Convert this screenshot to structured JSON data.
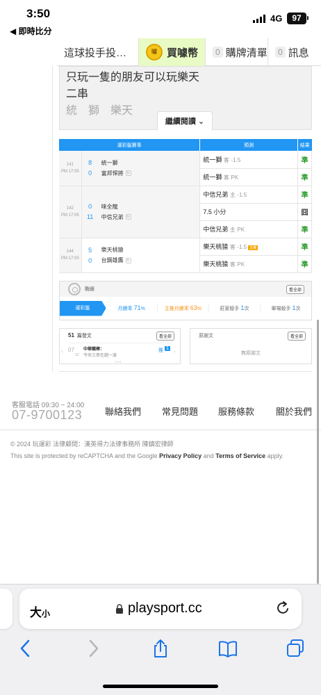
{
  "status_bar": {
    "time": "3:50",
    "back_app": "◀ 即時比分",
    "network": "4G",
    "battery": "97"
  },
  "topnav": {
    "post_label": "這球投手投…",
    "buy_label": "買噱幣",
    "coin_icon_text": "噱",
    "cart_count": "0",
    "cart_label": "購牌清單",
    "msg_count": "0",
    "msg_label": "訊息"
  },
  "article": {
    "lines": [
      "只玩一隻的朋友可以玩樂天",
      "二串",
      "統　獅　樂天"
    ],
    "read_more": "繼續閱讀"
  },
  "predictions": {
    "headers": {
      "game": "運彩盤賽事",
      "pick": "預測",
      "result": "結果"
    },
    "games": [
      {
        "no": "141",
        "time": "PM 17:05",
        "teams": [
          {
            "score": "8",
            "name": "統一獅"
          },
          {
            "score": "0",
            "name": "富邦悍將"
          }
        ],
        "picks": [
          {
            "team": "統一獅",
            "side": "客",
            "line": "-1.5",
            "hot": "",
            "result": "準"
          },
          {
            "team": "統一獅",
            "side": "客",
            "line": "PK",
            "hot": "",
            "result": "準"
          }
        ]
      },
      {
        "no": "142",
        "time": "PM 17:05",
        "teams": [
          {
            "score": "0",
            "name": "味全龍"
          },
          {
            "score": "11",
            "name": "中信兄弟"
          }
        ],
        "picks": [
          {
            "team": "中信兄弟",
            "side": "主",
            "line": "-1.5",
            "hot": "",
            "result": "準"
          },
          {
            "team": "7.5 小分",
            "side": "",
            "line": "",
            "hot": "",
            "result": "囧"
          },
          {
            "team": "中信兄弟",
            "side": "主",
            "line": "PK",
            "hot": "",
            "result": "準"
          }
        ]
      },
      {
        "no": "144",
        "time": "PM 17:05",
        "teams": [
          {
            "score": "5",
            "name": "樂天桃猿"
          },
          {
            "score": "0",
            "name": "台鋼雄鷹"
          }
        ],
        "picks": [
          {
            "team": "樂天桃猿",
            "side": "客",
            "line": "-1.5",
            "hot": "主推",
            "result": "準"
          },
          {
            "team": "樂天桃猿",
            "side": "客",
            "line": "PK",
            "hot": "",
            "result": "準"
          }
        ]
      }
    ],
    "tv_tag": "tv"
  },
  "stats": {
    "title": "戰績",
    "see_all": "看全部",
    "tab": "運彩盤",
    "month_label": "月勝率",
    "month_value": "71",
    "main_label": "主推月勝率",
    "main_value": "63",
    "streak_label": "莊家殺手",
    "streak_value": "1",
    "single_label": "單場殺手",
    "single_value": "1",
    "count_unit": "次",
    "pct": "%"
  },
  "posts": {
    "left_count": "51",
    "left_title": "篇發文",
    "left_see_all": "看全部",
    "post_date_day": "07",
    "post_date_month": "12",
    "post_author": "中華職棒：",
    "post_text": "今天三串在趟一波",
    "post_tag": "推",
    "post_tag_num": "1",
    "right_title": "原謝文",
    "right_see_all": "看全部",
    "right_empty": "無原謝文"
  },
  "footer": {
    "contact_label": "客服電話 09:30 ~ 24:00",
    "phone": "07-9700123",
    "links": [
      "聯絡我們",
      "常見問題",
      "服務條款",
      "關於我們"
    ],
    "copyright": "© 2024 玩運彩 法律顧問：漢英得力法律事務所 陳鎮宏律師",
    "recaptcha_pre": "This site is protected by reCAPTCHA and the Google",
    "privacy": "Privacy Policy",
    "and": "and",
    "terms": "Terms of Service",
    "apply": "apply."
  },
  "browser": {
    "aa_big": "大",
    "aa_small": "小",
    "url": "playsport.cc"
  }
}
